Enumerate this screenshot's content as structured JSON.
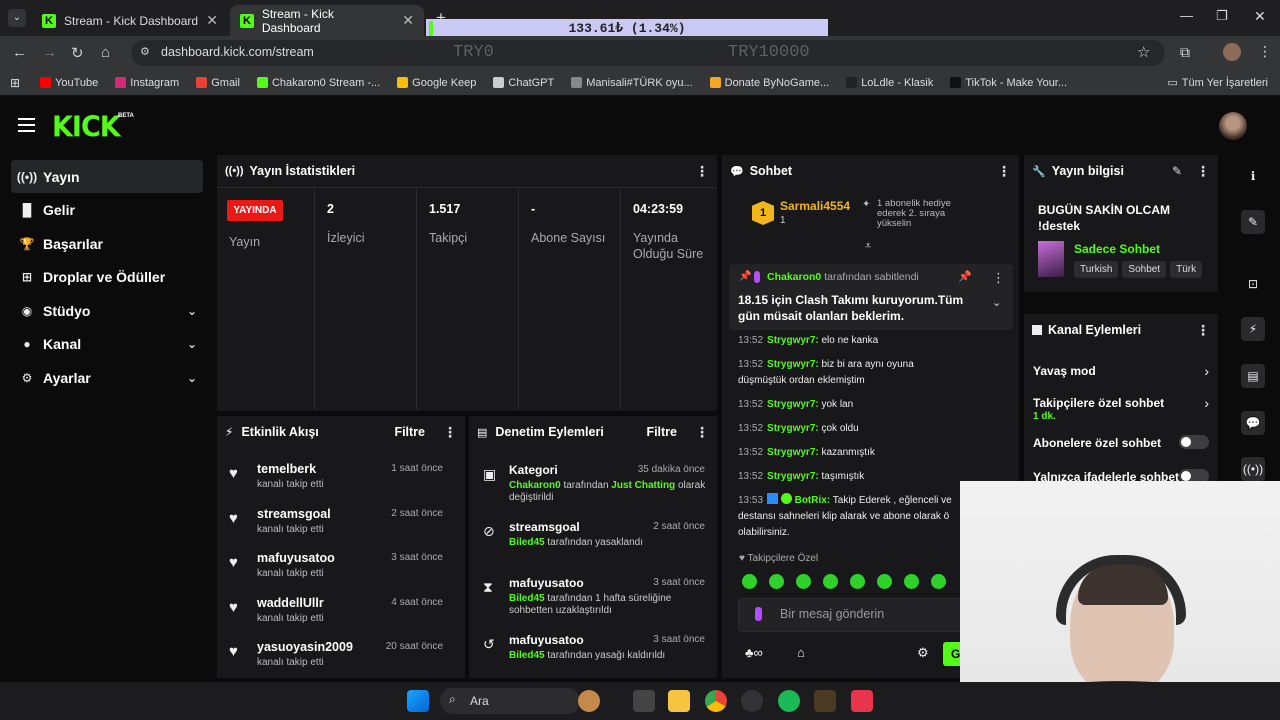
{
  "browser": {
    "tabs": [
      {
        "label": "Stream - Kick Dashboard"
      },
      {
        "label": "Stream - Kick Dashboard"
      }
    ],
    "url": "dashboard.kick.com/stream",
    "ticker": "133.61₺ (1.34%)",
    "ticker_left": "TRY0",
    "ticker_right": "TRY10000",
    "bookmarks": [
      {
        "label": "YouTube",
        "color": "#ff0000"
      },
      {
        "label": "Instagram",
        "color": "#d62976"
      },
      {
        "label": "Gmail",
        "color": "#ea4335"
      },
      {
        "label": "Chakaron0 Stream -...",
        "color": "#53fc18"
      },
      {
        "label": "Google Keep",
        "color": "#fbbc04"
      },
      {
        "label": "ChatGPT",
        "color": "#cccccc"
      },
      {
        "label": "Manisali#TÜRK oyu...",
        "color": "#888888"
      },
      {
        "label": "Donate ByNoGame...",
        "color": "#f5a623"
      },
      {
        "label": "LoLdle - Klasik",
        "color": "#222222"
      },
      {
        "label": "TikTok - Make Your...",
        "color": "#111111"
      }
    ],
    "all_bookmarks": "Tüm Yer İşaretleri"
  },
  "brand": {
    "logo": "KICK",
    "beta": "BETA"
  },
  "sidebar": [
    {
      "label": "Yayın",
      "icon": "broadcast-icon",
      "active": true
    },
    {
      "label": "Gelir",
      "icon": "bar-chart-icon"
    },
    {
      "label": "Başarılar",
      "icon": "trophy-icon"
    },
    {
      "label": "Droplar ve Ödüller",
      "icon": "gift-icon"
    },
    {
      "label": "Stüdyo",
      "icon": "palette-icon",
      "expand": true
    },
    {
      "label": "Kanal",
      "icon": "user-icon",
      "expand": true
    },
    {
      "label": "Ayarlar",
      "icon": "gear-icon",
      "expand": true
    }
  ],
  "stats": {
    "title": "Yayın İstatistikleri",
    "live_badge": "YAYINDA",
    "items": [
      {
        "value": "",
        "label": "Yayın"
      },
      {
        "value": "2",
        "label": "İzleyici"
      },
      {
        "value": "1.517",
        "label": "Takipçi"
      },
      {
        "value": "-",
        "label": "Abone Sayısı"
      },
      {
        "value": "04:23:59",
        "label": "Yayında Olduğu Süre"
      }
    ]
  },
  "activity": {
    "title": "Etkinlik Akışı",
    "filter": "Filtre",
    "items": [
      {
        "name": "temelberk",
        "sub": "kanalı takip etti",
        "time": "1 saat önce"
      },
      {
        "name": "streamsgoal",
        "sub": "kanalı takip etti",
        "time": "2 saat önce"
      },
      {
        "name": "mafuyusatoo",
        "sub": "kanalı takip etti",
        "time": "3 saat önce"
      },
      {
        "name": "waddellUllr",
        "sub": "kanalı takip etti",
        "time": "4 saat önce"
      },
      {
        "name": "yasuoyasin2009",
        "sub": "kanalı takip etti",
        "time": "20 saat önce"
      }
    ]
  },
  "moderation": {
    "title": "Denetim Eylemleri",
    "filter": "Filtre",
    "items": [
      {
        "icon": "category-icon",
        "name": "Kategori",
        "time": "35 dakika önce",
        "actor": "Chakaron0",
        "mid": " tarafından ",
        "extra": "Just Chatting",
        "rest": "olarak değiştirildi"
      },
      {
        "icon": "ban-icon",
        "name": "streamsgoal",
        "time": "2 saat önce",
        "actor": "Biled45",
        "mid": " tarafından yasaklandı",
        "extra": "",
        "rest": ""
      },
      {
        "icon": "hourglass-icon",
        "name": "mafuyusatoo",
        "time": "3 saat önce",
        "actor": "Biled45",
        "mid": " tarafından 1 hafta süreliğine sohbetten uzaklaştırıldı",
        "extra": "",
        "rest": ""
      },
      {
        "icon": "undo-icon",
        "name": "mafuyusatoo",
        "time": "3 saat önce",
        "actor": "Biled45",
        "mid": " tarafından yasağı kaldırıldı",
        "extra": "",
        "rest": ""
      }
    ]
  },
  "chat": {
    "title": "Sohbet",
    "top_gifter": {
      "name": "Sarmali4554",
      "count": "1",
      "note": "1 abonelik hediye ederek 2. sıraya yükselin"
    },
    "pinned": {
      "by_user": "Chakaron0",
      "by_text": "tarafından sabitlendi",
      "text": "18.15 için Clash Takımı kuruyorum.Tüm gün müsait olanları beklerim."
    },
    "messages": [
      {
        "time": "13:52",
        "user": "Strygwyr7:",
        "text": "elo ne kanka"
      },
      {
        "time": "13:52",
        "user": "Strygwyr7:",
        "text": "biz bi ara aynı oyuna düşmüştük ordan eklemiştim"
      },
      {
        "time": "13:52",
        "user": "Strygwyr7:",
        "text": "yok lan"
      },
      {
        "time": "13:52",
        "user": "Strygwyr7:",
        "text": "çok oldu"
      },
      {
        "time": "13:52",
        "user": "Strygwyr7:",
        "text": "kazanmıştık"
      },
      {
        "time": "13:52",
        "user": "Strygwyr7:",
        "text": "taşımıştık"
      },
      {
        "time": "13:53",
        "user": "BotRix:",
        "text": "Takip Ederek , eğlenceli ve destansı sahneleri klip alarak ve abone olarak ö olabilirsiniz."
      }
    ],
    "followers_only": "Takipçilere Özel",
    "input_placeholder": "Bir mesaj gönderin",
    "send": "G"
  },
  "stream_info": {
    "title": "Yayın bilgisi",
    "stream_title": "BUGÜN SAKİN OLCAM !destek",
    "category": "Sadece Sohbet",
    "tags": [
      "Turkish",
      "Sohbet",
      "Türk"
    ]
  },
  "channel_actions": {
    "title": "Kanal Eylemleri",
    "items": [
      {
        "label": "Yavaş mod",
        "sub": "",
        "type": "arrow"
      },
      {
        "label": "Takipçilere özel sohbet",
        "sub": "1 dk.",
        "type": "arrow"
      },
      {
        "label": "Abonelere özel sohbet",
        "sub": "",
        "type": "toggle"
      },
      {
        "label": "Yalnızca ifadelerle sohbet",
        "sub": "",
        "type": "toggle"
      }
    ]
  },
  "taskbar": {
    "search": "Ara"
  }
}
